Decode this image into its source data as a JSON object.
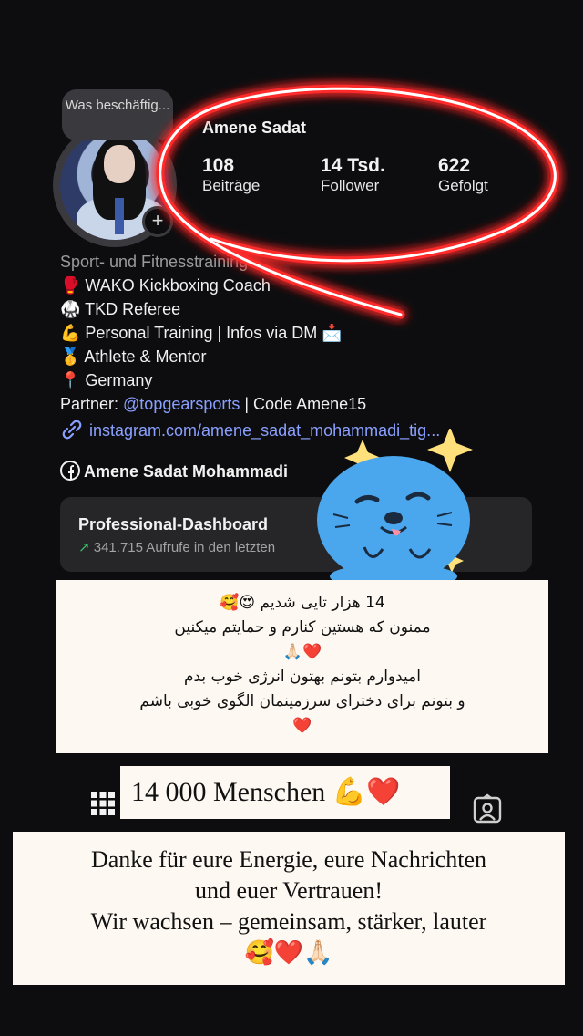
{
  "profile": {
    "tooltip": "Was beschäftig...",
    "name": "Amene Sadat",
    "add_glyph": "+",
    "stats": [
      {
        "value": "108",
        "label": "Beiträge"
      },
      {
        "value": "14 Tsd.",
        "label": "Follower"
      },
      {
        "value": "622",
        "label": "Gefolgt"
      }
    ]
  },
  "bio": {
    "category": "Sport- und Fitnesstraining",
    "lines": [
      "🥊 WAKO Kickboxing Coach",
      "🥋 TKD Referee",
      "💪 Personal Training | Infos via DM 📩",
      "🥇 Athlete & Mentor",
      "📍 Germany"
    ],
    "partner_prefix": "Partner: ",
    "partner_mention": "@topgearsports",
    "partner_suffix": " | Code Amene15",
    "link": "instagram.com/amene_sadat_mohammadi_tig...",
    "facebook": "Amene Sadat Mohammadi"
  },
  "dashboard": {
    "title": "Professional-Dashboard",
    "arrow": "↗",
    "subtitle": "341.715 Aufrufe in den letzten"
  },
  "overlay_fa": {
    "lines": [
      "14 هزار تایی شدیم 😍🥰",
      "ممنون که هستین کنارم و حمایتم میکنین",
      "❤️🙏🏻",
      "امیدوارم بتونم بهتون انرژی خوب بدم",
      "و بتونم برای دخترای سرزمینمان الگوی خوبی باشم",
      "❤️"
    ]
  },
  "overlay_de_title": "14 000 Menschen 💪❤️",
  "overlay_de": {
    "lines": [
      "Danke für eure Energie, eure Nachrichten",
      "und euer Vertrauen!",
      "Wir wachsen – gemeinsam, stärker, lauter",
      "🥰❤️🙏🏻"
    ]
  },
  "icons": [
    "grid-icon",
    "tagged-icon",
    "link-icon",
    "facebook-icon",
    "trend-arrow-icon"
  ],
  "colors": {
    "neon": "#ff2a2a",
    "link": "#8aa0ff",
    "sticker": "#4aa7ee"
  }
}
